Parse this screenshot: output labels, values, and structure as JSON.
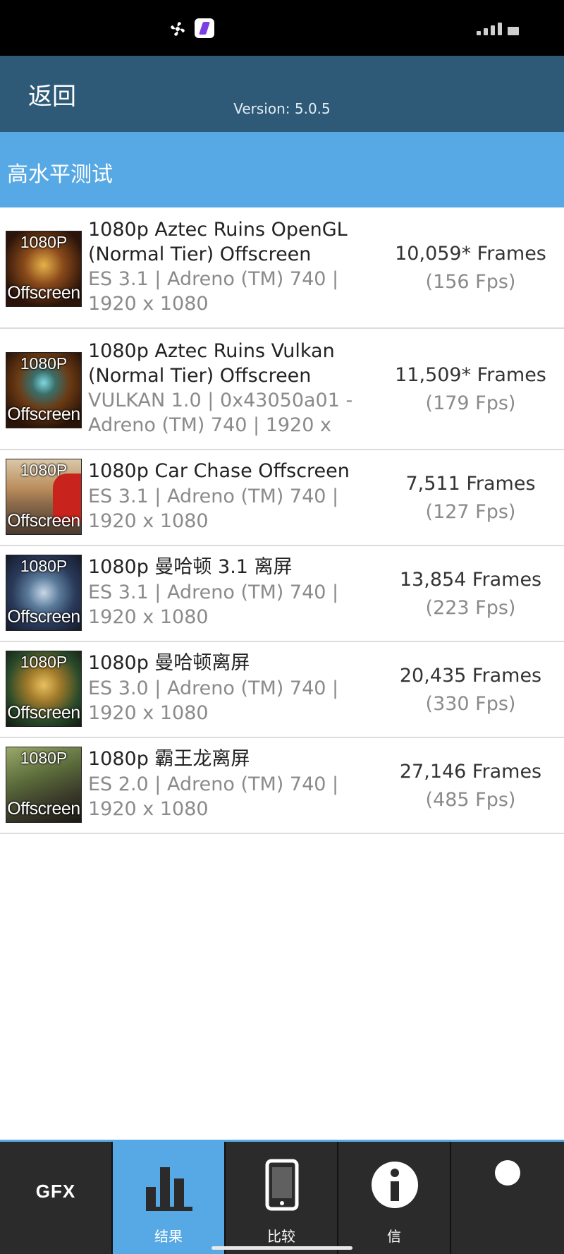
{
  "header": {
    "back_label": "返回",
    "version": "Version: 5.0.5"
  },
  "section": {
    "title": "高水平测试"
  },
  "results": [
    {
      "thumb_top": "1080P",
      "thumb_bottom": "Offscreen",
      "name": "1080p Aztec Ruins OpenGL (Normal Tier) Offscreen",
      "details": "ES 3.1 | Adreno (TM) 740 | 1920 x 1080",
      "score": "10,059* Frames",
      "fps": "(156 Fps)"
    },
    {
      "thumb_top": "1080P",
      "thumb_bottom": "Offscreen",
      "name": "1080p Aztec Ruins Vulkan (Normal Tier) Offscreen",
      "details": "VULKAN 1.0 | 0x43050a01 - Adreno (TM) 740 | 1920 x",
      "score": "11,509* Frames",
      "fps": "(179 Fps)"
    },
    {
      "thumb_top": "1080P",
      "thumb_bottom": "Offscreen",
      "name": "1080p Car Chase Offscreen",
      "details": "ES 3.1 | Adreno (TM) 740 | 1920 x 1080",
      "score": "7,511 Frames",
      "fps": "(127 Fps)"
    },
    {
      "thumb_top": "1080P",
      "thumb_bottom": "Offscreen",
      "name": "1080p 曼哈顿 3.1 离屏",
      "details": "ES 3.1 | Adreno (TM) 740 | 1920 x 1080",
      "score": "13,854 Frames",
      "fps": "(223 Fps)"
    },
    {
      "thumb_top": "1080P",
      "thumb_bottom": "Offscreen",
      "name": "1080p 曼哈顿离屏",
      "details": "ES 3.0 | Adreno (TM) 740 | 1920 x 1080",
      "score": "20,435 Frames",
      "fps": "(330 Fps)"
    },
    {
      "thumb_top": "1080P",
      "thumb_bottom": "Offscreen",
      "name": "1080p 霸王龙离屏",
      "details": "ES 2.0 | Adreno (TM) 740 | 1920 x 1080",
      "score": "27,146 Frames",
      "fps": "(485 Fps)"
    }
  ],
  "nav": {
    "gfx_logo": "GFX",
    "results_label": "结果",
    "compare_label": "比较",
    "info_label": "信",
    "active": "results"
  },
  "colors": {
    "header": "#2e5a78",
    "section_bar": "#56a9e4",
    "nav_bg": "#2b2b2b",
    "nav_active": "#56a9e4"
  },
  "icons": {
    "status": [
      "fan-icon",
      "app-icon",
      "signal-icon"
    ],
    "nav": [
      "gfx-logo",
      "bar-chart-icon",
      "phone-icon",
      "info-icon",
      "user-icon"
    ]
  }
}
